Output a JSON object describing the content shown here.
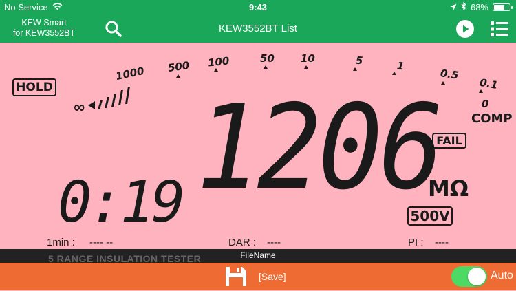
{
  "status_bar": {
    "carrier": "No Service",
    "time": "9:43",
    "battery": "68%",
    "battery_level": 0.68
  },
  "navbar": {
    "app_name_line1": "KEW Smart",
    "app_name_line2": "for KEW3552BT",
    "title": "KEW3552BT List"
  },
  "lcd": {
    "hold": "HOLD",
    "scale": [
      "500",
      "100",
      "50",
      "10",
      "5",
      "1",
      "0.5",
      "0.1",
      "0"
    ],
    "scale_1000": "1000",
    "infinity": "∞",
    "comp": "COMP",
    "fail": "FAIL",
    "reading": "1206",
    "unit": "MΩ",
    "voltage": "500V",
    "timer": "0:19",
    "one_min_label": "1min :",
    "one_min_value": "---- --",
    "dar_label": "DAR :",
    "dar_value": "----",
    "pi_label": "PI :",
    "pi_value": "----"
  },
  "file_bar": {
    "file_name_label": "FileName",
    "model_text": "5 RANGE INSULATION TESTER"
  },
  "bottom_bar": {
    "save_label": "[Save]",
    "auto_label": "Auto",
    "auto_enabled": true
  },
  "colors": {
    "header_green": "#1aa759",
    "lcd_pink": "#ffb3bf",
    "bottom_orange": "#ee6c33",
    "toggle_on": "#4cd964"
  }
}
